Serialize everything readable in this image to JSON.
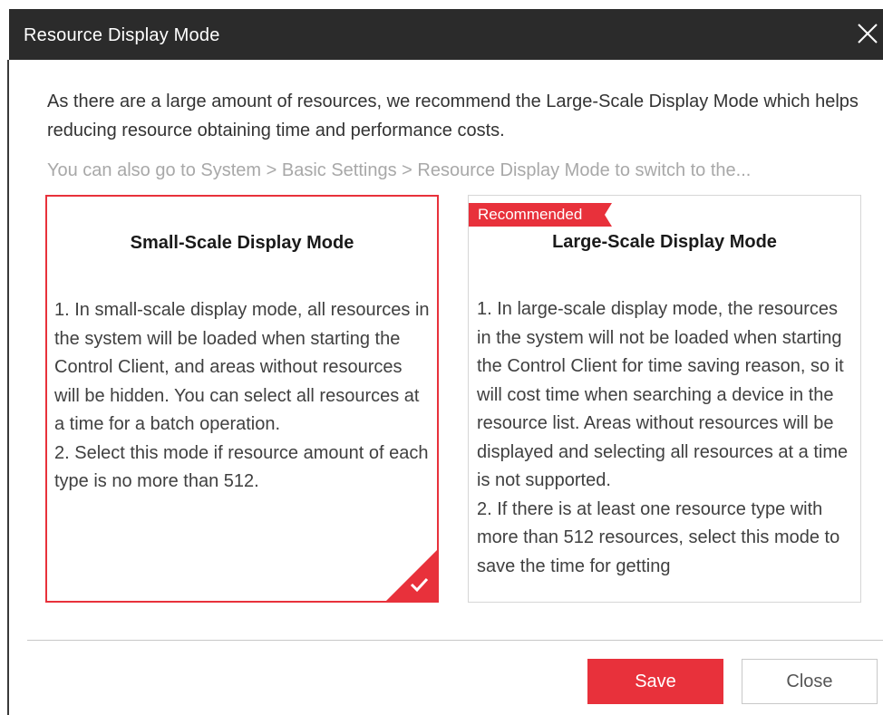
{
  "dialog": {
    "title": "Resource Display Mode",
    "description": "As there are a large amount of resources, we recommend the Large-Scale Display Mode which helps reducing resource obtaining time and performance costs.",
    "hint": "You can also go to System > Basic Settings  > Resource Display Mode to switch to the..."
  },
  "modes": {
    "small": {
      "title": "Small-Scale Display Mode",
      "body": "1. In small-scale display mode, all resources in the system will be loaded when starting the Control Client, and areas without resources will be hidden. You can select all resources at a time for a batch operation.\n2. Select this mode if resource amount of each type is no more than 512.",
      "selected": true
    },
    "large": {
      "badge": "Recommended",
      "title": "Large-Scale Display Mode",
      "body": "1. In large-scale display mode, the resources in the system will not be loaded when starting the Control Client for time saving reason, so it will cost time when searching a device in the resource list. Areas without resources will be displayed and selecting all resources at a time is not supported.\n2. If there is at least one resource type with more than 512 resources, select this mode to save the time for getting"
    }
  },
  "buttons": {
    "save": "Save",
    "close": "Close"
  },
  "icons": {
    "close": "close-icon",
    "check": "check-icon"
  },
  "colors": {
    "accent": "#e8313b",
    "titlebar": "#2b2b2b"
  }
}
